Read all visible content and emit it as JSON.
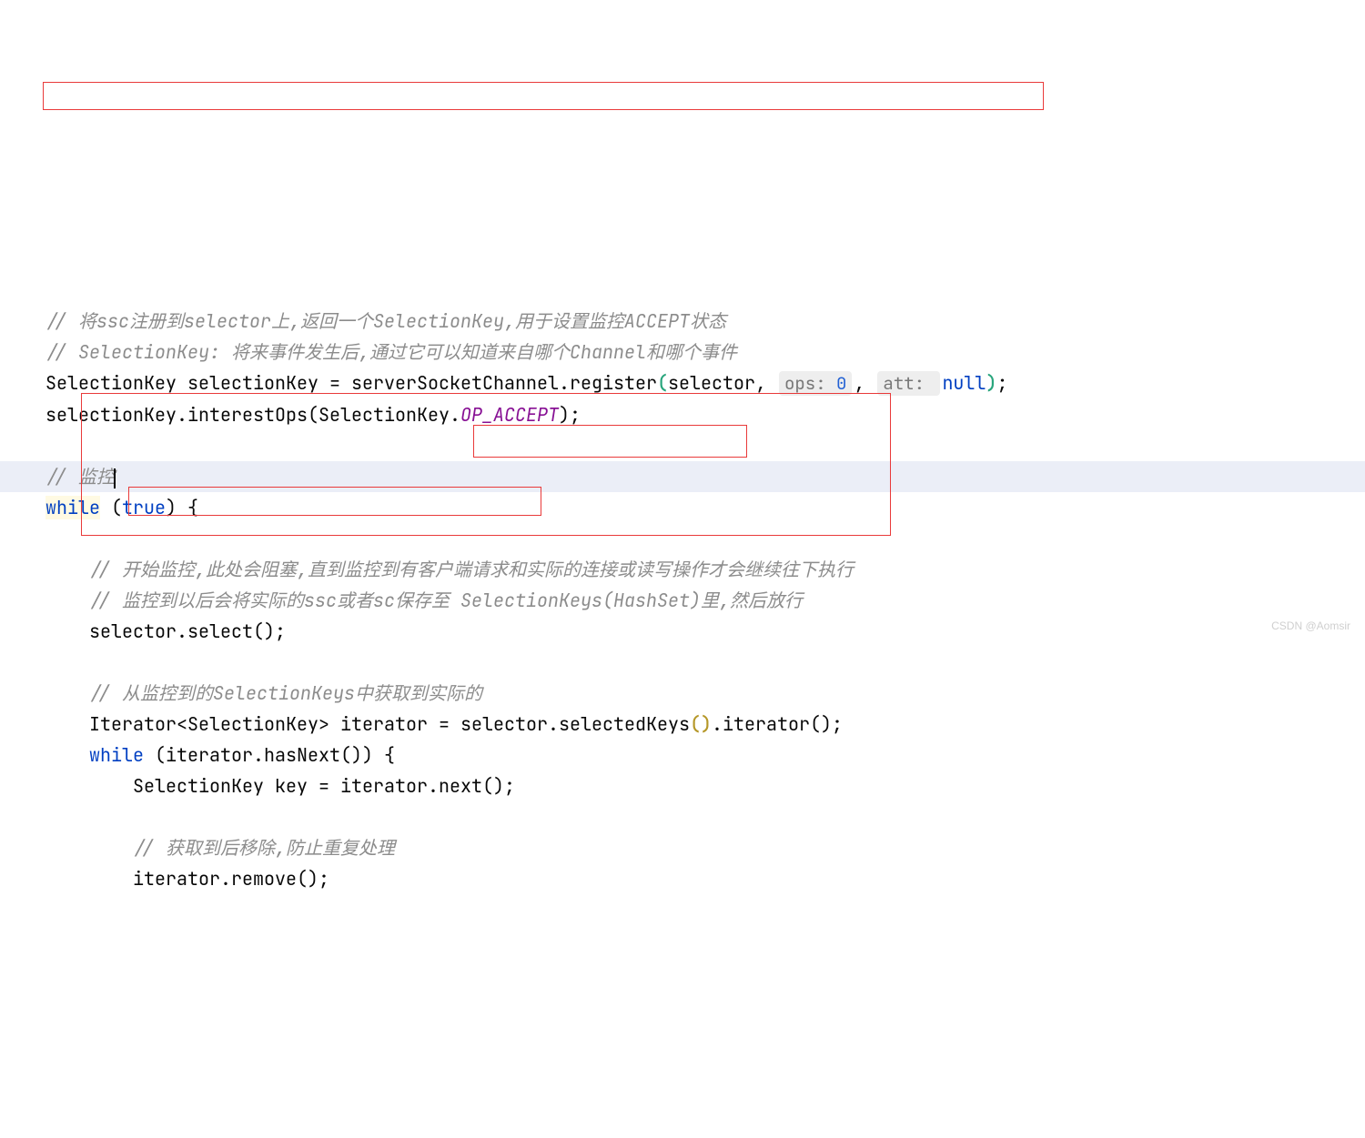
{
  "lines": {
    "c1": "// 将ssc注册到selector上,返回一个SelectionKey,用于设置监控ACCEPT状态",
    "c2": "// SelectionKey: 将来事件发生后,通过它可以知道来自哪个Channel和哪个事件",
    "l3_a": "SelectionKey selectionKey = serverSocketChannel.register",
    "l3_b": "selector, ",
    "l3_hint1_lbl": "ops:",
    "l3_hint1_val": "0",
    "l3_c": ", ",
    "l3_hint2_lbl": "att:",
    "l3_null": "null",
    "l3_end": ";",
    "l4_a": "selectionKey.interestOps",
    "l4_b": "SelectionKey.",
    "l4_c": "OP_ACCEPT",
    "l4_end": ";",
    "c5": "// 监控",
    "l6_while": "while",
    "l6_true": "true",
    "l6_brace": " {",
    "c7": "// 开始监控,此处会阻塞,直到监控到有客户端请求和实际的连接或读写操作才会继续往下执行",
    "c8": "// 监控到以后会将实际的ssc或者sc保存至 SelectionKeys(HashSet)里,然后放行",
    "l9_a": "selector.select",
    "l9_end": ";",
    "c10": "// 从监控到的SelectionKeys中获取到实际的",
    "l11_a": "Iterator<SelectionKey> iterator = ",
    "l11_b": "selector.selectedKeys",
    "l11_c": ".iterator",
    "l11_end": ";",
    "l12_while": "while",
    "l12_a": "iterator.hasNext",
    "l12_brace": " {",
    "l13_a": "SelectionKey key = iterator.next",
    "l13_end": ";",
    "c14": "// 获取到后移除,防止重复处理",
    "l15_a": "iterator.remove",
    "l15_end": ";"
  },
  "watermark": "CSDN @Aomsir"
}
